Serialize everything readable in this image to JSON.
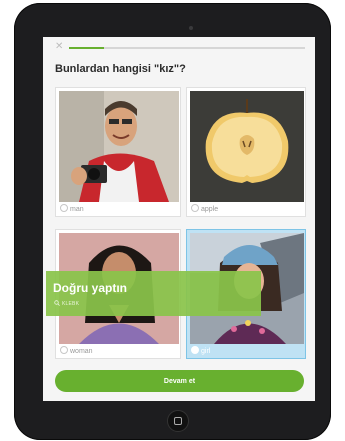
{
  "lesson": {
    "question": "Bunlardan hangisi \"kız\"?",
    "progress_fraction": 0.15
  },
  "options": [
    {
      "label": "man",
      "selected": false
    },
    {
      "label": "apple",
      "selected": false
    },
    {
      "label": "woman",
      "selected": false
    },
    {
      "label": "girl",
      "selected": true
    }
  ],
  "feedback": {
    "title": "Doğru yaptın",
    "subtitle": "KLEBK"
  },
  "continue_button": {
    "label": "Devam et"
  },
  "colors": {
    "accent_green": "#68b02f",
    "selected_blue": "#bfe2f4",
    "feedback_green": "#8ac44a"
  },
  "icons": [
    "close-icon",
    "radio-icon",
    "home-button-icon",
    "search-icon"
  ]
}
